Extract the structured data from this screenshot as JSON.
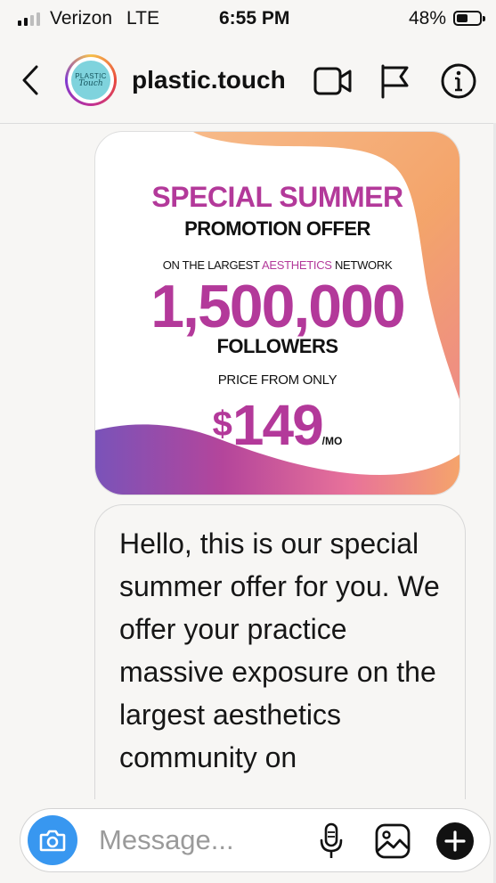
{
  "status_bar": {
    "carrier": "Verizon",
    "network": "LTE",
    "time": "6:55 PM",
    "battery_percent": "48%",
    "battery_level": 0.48,
    "signal_bars": 2
  },
  "header": {
    "username": "plastic.touch",
    "avatar_text_top": "PLASTIC",
    "avatar_text_bottom": "Touch",
    "icons": [
      "back-chevron-icon",
      "video-camera-icon",
      "flag-icon",
      "info-icon"
    ]
  },
  "promo_image": {
    "title": "SPECIAL SUMMER",
    "subtitle": "PROMOTION OFFER",
    "network_pre": "ON THE LARGEST ",
    "network_highlight": "AESTHETICS",
    "network_post": " NETWORK",
    "followers_count": "1,500,000",
    "followers_label": "FOLLOWERS",
    "price_label": "PRICE FROM ONLY",
    "price_currency": "$",
    "price_value": "149",
    "price_unit": "/MO",
    "colors": {
      "accent": "#b3399a",
      "orange": "#f2a05a",
      "purple": "#7a4fb8"
    }
  },
  "message": {
    "text": "Hello, this is our special summer offer for you. We offer your practice massive exposure on the largest aesthetics community on"
  },
  "composer": {
    "placeholder": "Message...",
    "icons": [
      "camera-icon",
      "microphone-icon",
      "gallery-icon",
      "add-icon"
    ]
  },
  "colors": {
    "brand_blue": "#3897f0",
    "background": "#f7f6f4"
  }
}
